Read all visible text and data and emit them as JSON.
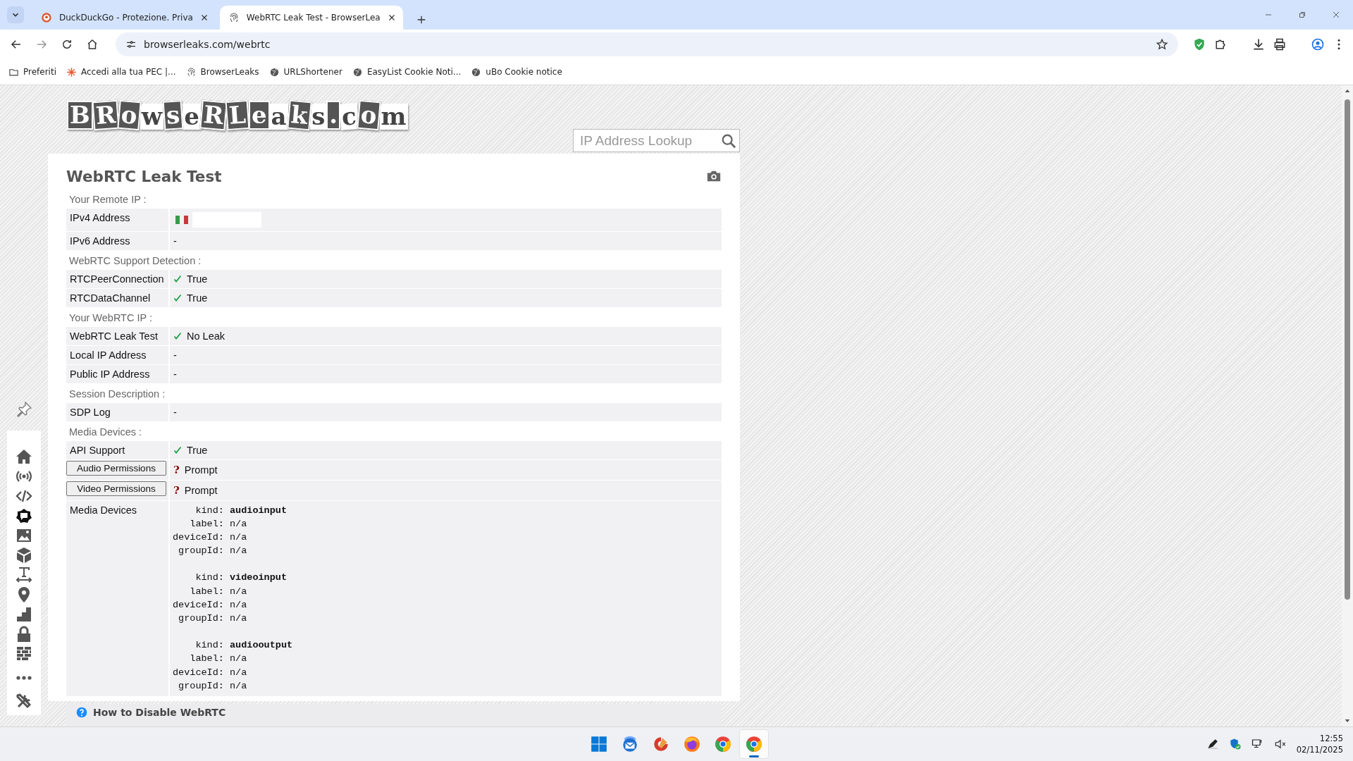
{
  "browser": {
    "tabs": [
      {
        "title": "DuckDuckGo - Protezione. Priva",
        "kind": "duck",
        "selected": false
      },
      {
        "title": "WebRTC Leak Test - BrowserLea",
        "kind": "fingerprint",
        "selected": true
      }
    ],
    "address": "browserleaks.com/webrtc",
    "bookmarks": [
      {
        "label": "Preferiti",
        "kind": "folder"
      },
      {
        "label": "Accedi alla tua PEC |...",
        "kind": "spark"
      },
      {
        "label": "BrowserLeaks",
        "kind": "fingerprint"
      },
      {
        "label": "URLShortener",
        "kind": "globe"
      },
      {
        "label": "EasyList Cookie Noti...",
        "kind": "globe"
      },
      {
        "label": "uBo Cookie notice",
        "kind": "globe"
      }
    ]
  },
  "page": {
    "logo": "BRowseRLeaks.com",
    "search": {
      "placeholder": "IP Address Lookup"
    },
    "title": "WebRTC Leak Test",
    "sections": [
      {
        "heading": "Your Remote IP :",
        "rows": [
          {
            "label": "IPv4 Address",
            "label_button": false,
            "kind": "flag"
          },
          {
            "label": "IPv6 Address",
            "label_button": false,
            "kind": "text",
            "value": "-"
          }
        ]
      },
      {
        "heading": "WebRTC Support Detection :",
        "rows": [
          {
            "label": "RTCPeerConnection",
            "label_button": false,
            "kind": "check",
            "value": "True"
          },
          {
            "label": "RTCDataChannel",
            "label_button": false,
            "kind": "check",
            "value": "True"
          }
        ]
      },
      {
        "heading": "Your WebRTC IP :",
        "rows": [
          {
            "label": "WebRTC Leak Test",
            "label_button": false,
            "kind": "check",
            "value": "No Leak"
          },
          {
            "label": "Local IP Address",
            "label_button": false,
            "kind": "text",
            "value": "-"
          },
          {
            "label": "Public IP Address",
            "label_button": false,
            "kind": "text",
            "value": "-"
          }
        ]
      },
      {
        "heading": "Session Description :",
        "rows": [
          {
            "label": "SDP Log",
            "label_button": false,
            "kind": "text",
            "value": "-"
          }
        ]
      },
      {
        "heading": "Media Devices :",
        "rows": [
          {
            "label": "API Support",
            "label_button": false,
            "kind": "check",
            "value": "True"
          },
          {
            "label": "Audio Permissions",
            "label_button": true,
            "kind": "prompt",
            "mark": "?",
            "value": "Prompt"
          },
          {
            "label": "Video Permissions",
            "label_button": true,
            "kind": "prompt",
            "mark": "?",
            "value": "Prompt"
          },
          {
            "label": "Media Devices",
            "label_button": false,
            "kind": "devices",
            "devices": [
              [
                "    kind: **audioinput**",
                "   label: n/a",
                "deviceId: n/a",
                " groupId: n/a"
              ],
              [
                "    kind: **videoinput**",
                "   label: n/a",
                "deviceId: n/a",
                " groupId: n/a"
              ],
              [
                "    kind: **audiooutput**",
                "   label: n/a",
                "deviceId: n/a",
                " groupId: n/a"
              ]
            ]
          }
        ]
      }
    ],
    "help_heading": "How to Disable WebRTC"
  },
  "taskbar": {
    "apps": [
      {
        "kind": "windows",
        "selected": false
      },
      {
        "kind": "mail",
        "selected": false
      },
      {
        "kind": "cleaner",
        "selected": false
      },
      {
        "kind": "firefox",
        "selected": false
      },
      {
        "kind": "chrome",
        "selected": false
      },
      {
        "kind": "chrome",
        "selected": true
      }
    ],
    "time": "12:55",
    "date": "02/11/2025"
  }
}
